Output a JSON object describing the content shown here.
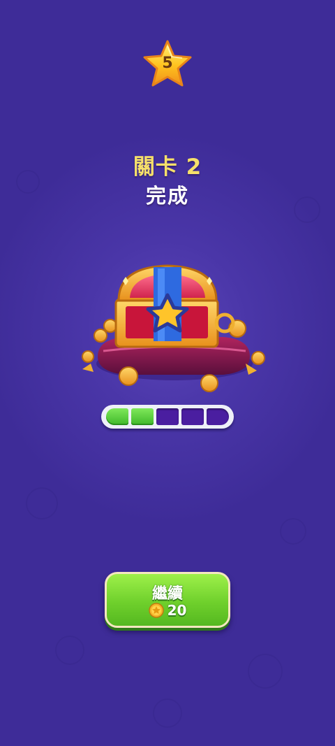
{
  "header": {
    "stars": "5",
    "star_icon": "star-icon"
  },
  "title": {
    "level": "關卡 2",
    "status": "完成"
  },
  "reward": {
    "icon": "treasure-chest-icon",
    "progress_filled": 2,
    "progress_total": 5
  },
  "continue_button": {
    "label": "繼續",
    "cost": "20",
    "cost_icon": "coin-icon"
  },
  "colors": {
    "background": "#3f2c99",
    "title_yellow": "#f6e06a",
    "progress_on": "#5fd33c",
    "progress_off": "#4a1ea0",
    "button_green": "#6fd02c"
  }
}
